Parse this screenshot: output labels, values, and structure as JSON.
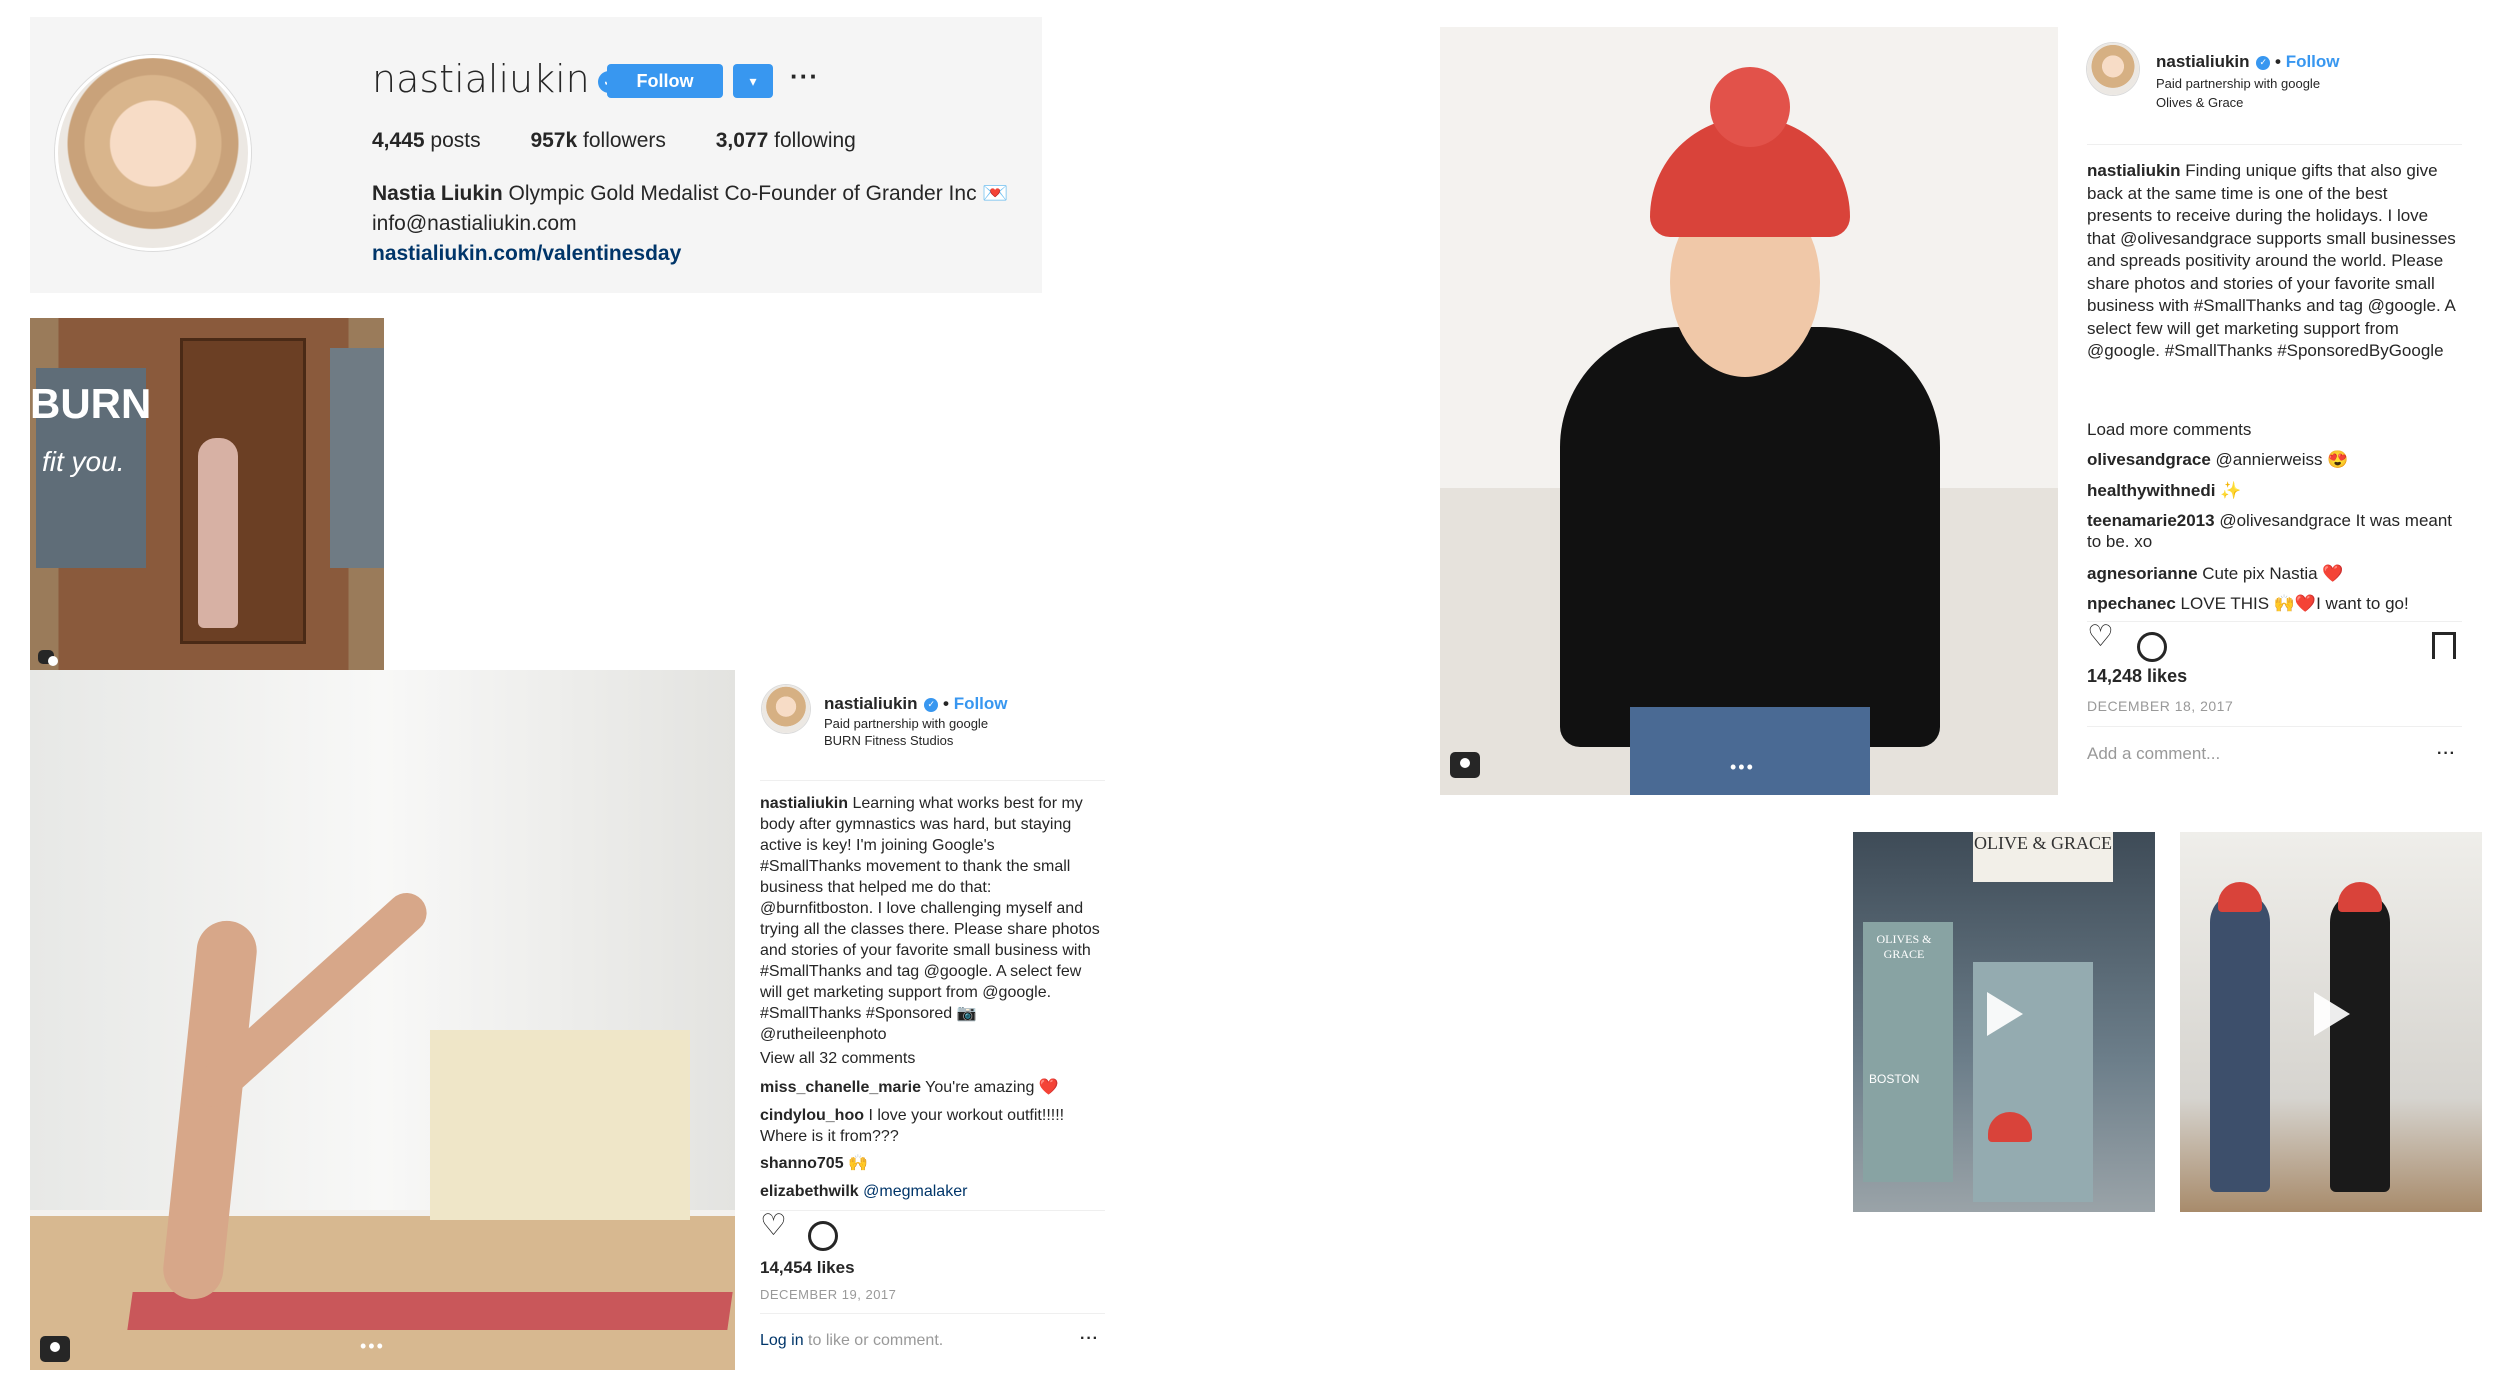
{
  "profile": {
    "username": "nastialiukin",
    "follow_label": "Follow",
    "dropdown_symbol": "▾",
    "more_symbol": "···",
    "stats": {
      "posts": "4,445",
      "posts_label": "posts",
      "followers": "957k",
      "followers_label": "followers",
      "following": "3,077",
      "following_label": "following"
    },
    "full_name": "Nastia Liukin",
    "bio": "Olympic Gold Medalist Co-Founder of Grander Inc 💌",
    "email": "info@nastialiukin.com",
    "website": "nastialiukin.com/valentinesday"
  },
  "burn_photo": {
    "sign_text": "BURN",
    "tagline": "fit you."
  },
  "post_burn": {
    "username": "nastialiukin",
    "follow_label": "Follow",
    "partnership": "Paid partnership with google",
    "location": "BURN Fitness Studios",
    "caption_user": "nastialiukin",
    "caption": "Learning what works best for my body after gymnastics was hard, but staying active is key! I'm joining Google's #SmallThanks movement to thank the small business that helped me do that: @burnfitboston. I love challenging myself and trying all the classes there. Please share photos and stories of your favorite small business with #SmallThanks and tag @google. A select few will get marketing support from @google. #SmallThanks #Sponsored 📷 @rutheileenphoto",
    "view_all": "View all 32 comments",
    "comments": [
      {
        "user": "miss_chanelle_marie",
        "text": "You're amazing ❤️"
      },
      {
        "user": "cindylou_hoo",
        "text": "I love your workout outfit!!!!! Where is it from???"
      },
      {
        "user": "shanno705",
        "text": "🙌"
      },
      {
        "user": "elizabethwilk",
        "text": "@megmalaker"
      }
    ],
    "likes": "14,454 likes",
    "date": "DECEMBER 19, 2017",
    "login_link": "Log in",
    "login_text": "to like or comment.",
    "more_symbol": "···"
  },
  "post_olives": {
    "username": "nastialiukin",
    "follow_label": "Follow",
    "partnership": "Paid partnership with google",
    "location": "Olives & Grace",
    "caption_user": "nastialiukin",
    "caption": "Finding unique gifts that also give back at the same time is one of the best presents to receive during the holidays. I love that @olivesandgrace supports small businesses and spreads positivity around the world. Please share photos and stories of your favorite small business with #SmallThanks and tag @google. A select few will get marketing support from @google. #SmallThanks #SponsoredByGoogle",
    "load_more": "Load more comments",
    "comments": [
      {
        "user": "olivesandgrace",
        "text": "@annierweiss 😍"
      },
      {
        "user": "healthywithnedi",
        "text": "✨"
      },
      {
        "user": "teenamarie2013",
        "text": "@olivesandgrace It was meant to be. xo"
      },
      {
        "user": "agnesorianne",
        "text": "Cute pix Nastia ❤️"
      },
      {
        "user": "npechanec",
        "text": "LOVE THIS 🙌❤️I want to go!"
      }
    ],
    "likes": "14,248 likes",
    "date": "DECEMBER 18, 2017",
    "add_comment": "Add a comment...",
    "more_symbol": "···"
  },
  "shop_photo": {
    "sign_text": "OLIVE & GRACE",
    "window_text": "OLIVES & GRACE",
    "street_text": "BOSTON"
  },
  "icons": {
    "verified": "check-badge-icon",
    "heart": "heart-icon",
    "comment": "comment-bubble-icon",
    "bookmark": "bookmark-icon",
    "carousel": "camera-tag-icon",
    "play": "play-icon"
  },
  "colors": {
    "accent": "#3897f0",
    "link": "#003569",
    "muted": "#999999",
    "header_bg": "#f5f5f5"
  }
}
